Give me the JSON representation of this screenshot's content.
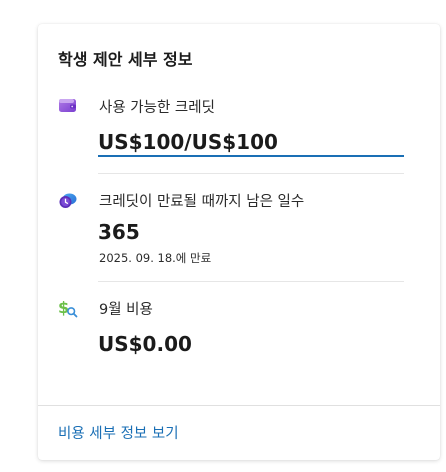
{
  "card": {
    "title": "학생 제안 세부 정보"
  },
  "credits": {
    "icon": "wallet-icon",
    "label": "사용 가능한 크레딧",
    "value": "US$100/US$100"
  },
  "days_left": {
    "icon": "clock-cloud-icon",
    "label": "크레딧이 만료될 때까지 남은 일수",
    "value": "365",
    "expiry": "2025. 09. 18.에 만료"
  },
  "cost": {
    "icon": "dollar-search-icon",
    "label": "9월 비용",
    "value": "US$0.00"
  },
  "footer": {
    "link": "비용 세부 정보 보기"
  },
  "colors": {
    "accent": "#1a6fb5",
    "wallet": "#8a4bd8",
    "dollar": "#6cc04a"
  }
}
